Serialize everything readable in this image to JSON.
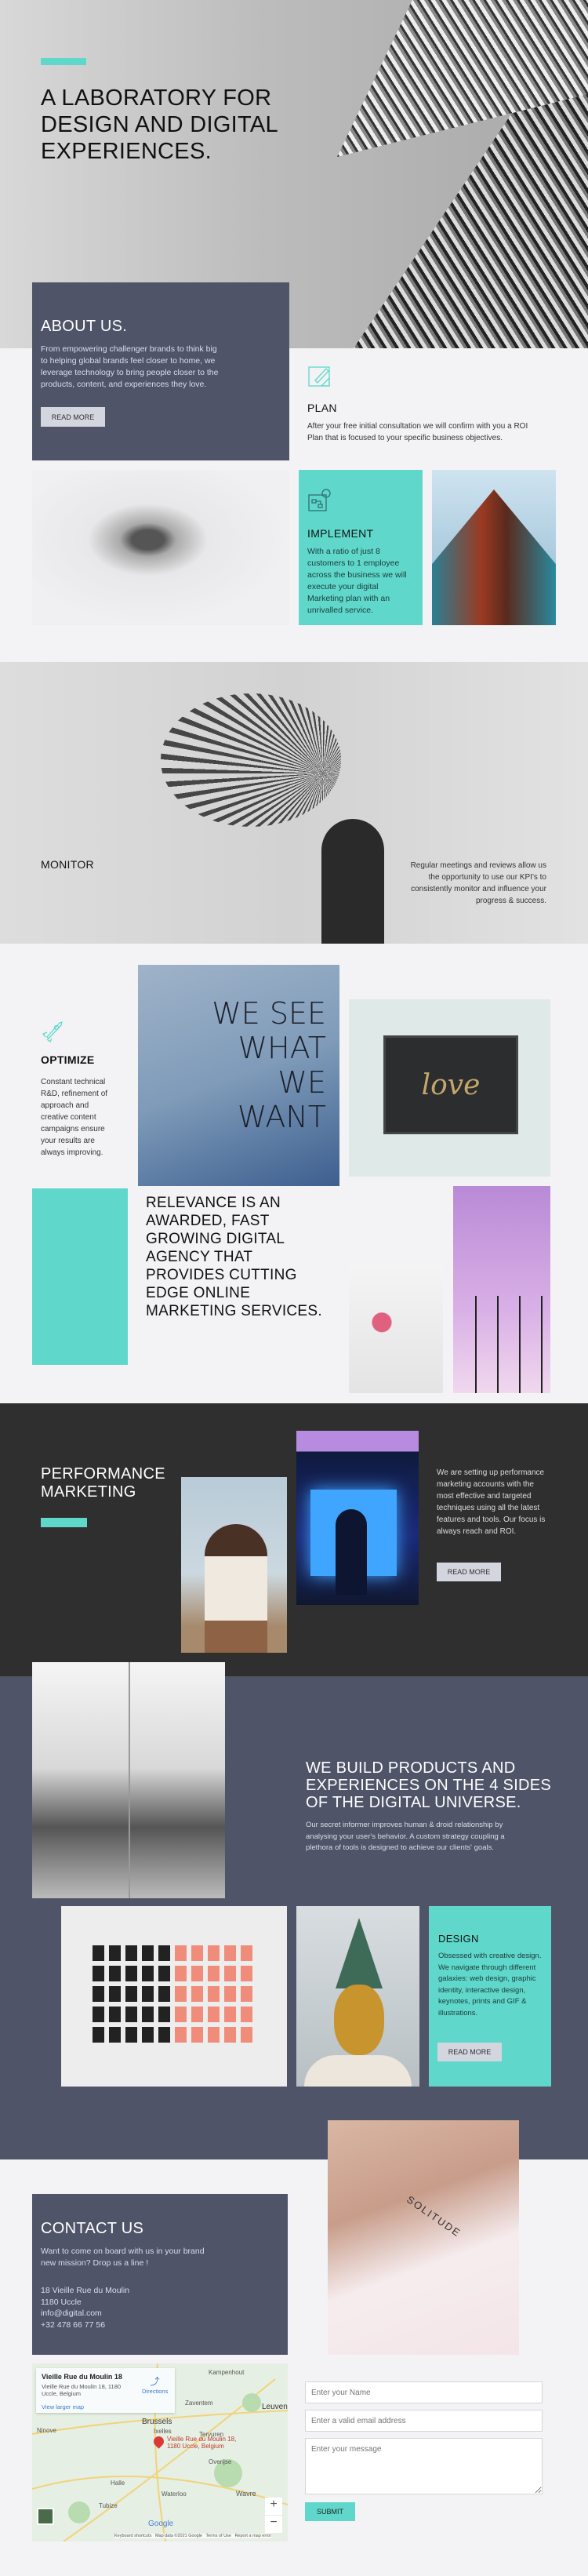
{
  "colors": {
    "accent": "#5fd8cb",
    "slate": "#4f5468",
    "dark": "#2f2f2f",
    "light": "#f3f3f5"
  },
  "hero": {
    "title": "A LABORATORY FOR DESIGN AND DIGITAL EXPERIENCES."
  },
  "about": {
    "title": "ABOUT US.",
    "text": "From empowering challenger brands to think big to helping global brands feel closer to home, we leverage technology to bring people closer to the products, content, and experiences they love.",
    "button": "READ MORE"
  },
  "plan": {
    "icon": "blueprint-pencil-icon",
    "title": "PLAN",
    "text": "After your free initial consultation we will confirm with you a ROI Plan that is focused to your specific business objectives."
  },
  "implement": {
    "icon": "blueprint-gear-icon",
    "title": "IMPLEMENT",
    "text": "With a ratio of just 8 customers to 1 employee across the business we will execute your digital Marketing plan with an unrivalled service."
  },
  "monitor": {
    "title": "MONITOR",
    "text": "Regular meetings and reviews allow us the opportunity to use our KPI's to consistently monitor and influence your progress & success."
  },
  "optimize": {
    "icon": "rocket-icon",
    "title": "OPTIMIZE",
    "text": "Constant technical R&D, refinement of approach and creative content campaigns ensure your results are always improving."
  },
  "relevance": {
    "title": "RELEVANCE IS AN AWARDED, FAST GROWING DIGITAL AGENCY THAT PROVIDES CUTTING EDGE ONLINE MARKETING SERVICES."
  },
  "images": {
    "denim_text": "WE SEE WHAT WE WANT",
    "love_text": "love",
    "tattoo_text": "SOLITUDE"
  },
  "performance": {
    "title": "PERFORMANCE MARKETING",
    "text": "We are setting up performance marketing accounts with the most effective and targeted techniques using all the latest features and tools. Our focus is always reach and ROI.",
    "button": "READ MORE"
  },
  "products": {
    "title": "WE BUILD PRODUCTS AND EXPERIENCES ON THE 4 SIDES OF THE DIGITAL UNIVERSE.",
    "text": "Our secret informer improves human & droid relationship by analysing your user's behavior. A custom strategy coupling a plethora of tools is designed to achieve our clients' goals."
  },
  "design": {
    "title": "DESIGN",
    "text": "Obsessed with creative design. We navigate through different galaxies: web design, graphic identity, interactive design, keynotes, prints and GIF & illustrations.",
    "button": "READ MORE"
  },
  "contact": {
    "title": "CONTACT US",
    "text": "Want to come on board with us in your brand new mission? Drop us a line !",
    "address": [
      "18 Vieille Rue du Moulin",
      "1180 Uccle",
      "info@digital.com",
      "+32 478 66 77 56"
    ]
  },
  "map": {
    "place": "Vieille Rue du Moulin 18",
    "address": "Vieille Rue du Moulin 18, 1180 Uccle, Belgium",
    "directions": "Directions",
    "larger": "View larger map",
    "pin_label": "Vieille Rue du Moulin 18, 1180 Uccle, Belgium",
    "cities": [
      "Brussels",
      "Leuven",
      "Ixelles",
      "Waterloo",
      "Wavre",
      "Halle",
      "Tubize",
      "Overijse",
      "Tervuren",
      "Zaventem",
      "Ninove",
      "Kampenhout"
    ],
    "footer": "Keyboard shortcuts   Map data ©2021 Google   Terms of Use   Report a map error",
    "zoom_in": "+",
    "zoom_out": "−",
    "logo": "Google"
  },
  "form": {
    "name_placeholder": "Enter your Name",
    "email_placeholder": "Enter a valid email address",
    "message_placeholder": "Enter your message",
    "submit": "SUBMIT"
  }
}
